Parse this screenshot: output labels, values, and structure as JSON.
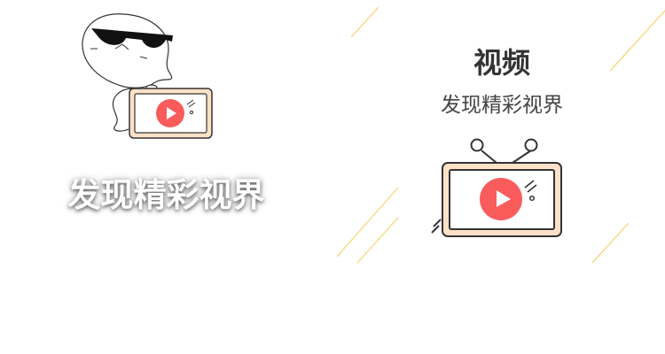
{
  "left": {
    "slogan": "发现精彩视界"
  },
  "right": {
    "title": "视频",
    "subtitle": "发现精彩视界"
  },
  "colors": {
    "play": "#fa5c5c",
    "tv_frame": "#ffe1c8",
    "outline": "#333333",
    "accent_line": "#f8d77a"
  },
  "icons": [
    "sunglasses-character-icon",
    "tv-play-icon"
  ]
}
